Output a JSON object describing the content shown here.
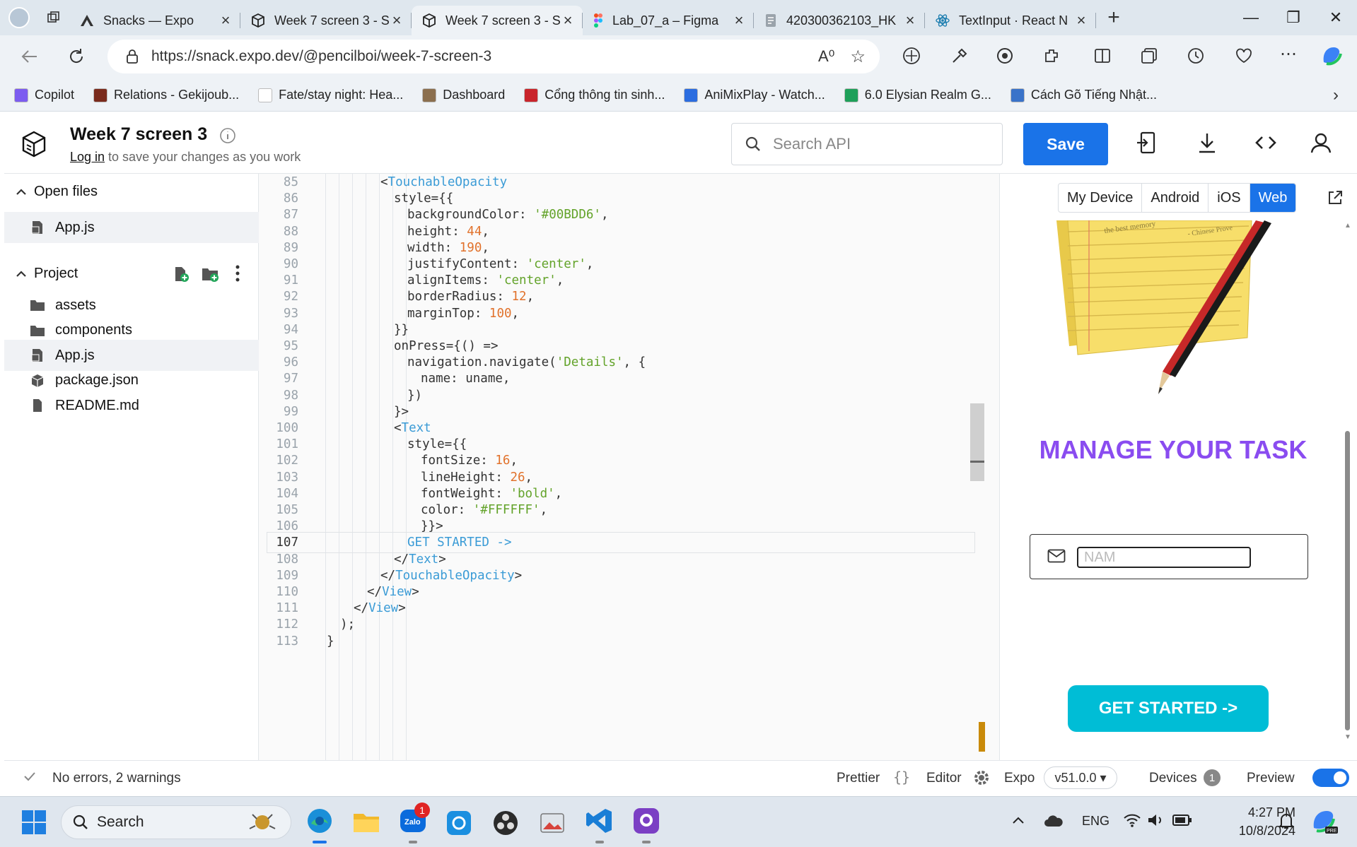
{
  "browser": {
    "tabs": [
      {
        "label": "Snacks — Expo",
        "icon": "expo-logo-icon",
        "active": false
      },
      {
        "label": "Week 7 screen 3 - S",
        "icon": "snack-cube-icon",
        "active": false
      },
      {
        "label": "Week 7 screen 3 - S",
        "icon": "snack-cube-icon",
        "active": true
      },
      {
        "label": "Lab_07_a – Figma",
        "icon": "figma-logo-icon",
        "active": false
      },
      {
        "label": "420300362103_HK",
        "icon": "document-icon",
        "active": false
      },
      {
        "label": "TextInput · React N",
        "icon": "react-logo-icon",
        "active": false
      }
    ],
    "url": "https://snack.expo.dev/@pencilboi/week-7-screen-3",
    "bookmarks": [
      {
        "label": "Copilot",
        "color": "#7c5cf0"
      },
      {
        "label": "Relations - Gekijoub...",
        "color": "#7a2b1c"
      },
      {
        "label": "Fate/stay night: Hea...",
        "color": "#ffffff"
      },
      {
        "label": "Dashboard",
        "color": "#8b6f4e"
      },
      {
        "label": "Cổng thông tin sinh...",
        "color": "#c9242b"
      },
      {
        "label": "AniMixPlay - Watch...",
        "color": "#2b6de0"
      },
      {
        "label": "6.0 Elysian Realm G...",
        "color": "#1ea05a"
      },
      {
        "label": "Cách Gõ Tiếng Nhật...",
        "color": "#3a73c9"
      }
    ]
  },
  "snack": {
    "title": "Week 7 screen 3",
    "login_link": "Log in",
    "login_suffix": " to save your changes as you work",
    "search_placeholder": "Search API",
    "save_label": "Save"
  },
  "sidebar": {
    "open_files_header": "Open files",
    "open_files": [
      {
        "label": "App.js",
        "icon": "js-file-icon"
      }
    ],
    "project_header": "Project",
    "project_items": [
      {
        "label": "assets",
        "icon": "folder-icon"
      },
      {
        "label": "components",
        "icon": "folder-icon"
      },
      {
        "label": "App.js",
        "icon": "js-file-icon"
      },
      {
        "label": "package.json",
        "icon": "package-icon"
      },
      {
        "label": "README.md",
        "icon": "document-icon"
      }
    ]
  },
  "editor": {
    "lines": [
      {
        "n": "85",
        "indent": 4,
        "parts": [
          [
            "",
            "<"
          ],
          [
            "tag",
            "TouchableOpacity"
          ]
        ]
      },
      {
        "n": "86",
        "indent": 5,
        "parts": [
          [
            "",
            "style={{"
          ]
        ]
      },
      {
        "n": "87",
        "indent": 6,
        "parts": [
          [
            "",
            "backgroundColor: "
          ],
          [
            "str",
            "'#00BDD6'"
          ],
          [
            "",
            ","
          ]
        ]
      },
      {
        "n": "88",
        "indent": 6,
        "parts": [
          [
            "",
            "height: "
          ],
          [
            "num",
            "44"
          ],
          [
            "",
            ","
          ]
        ]
      },
      {
        "n": "89",
        "indent": 6,
        "parts": [
          [
            "",
            "width: "
          ],
          [
            "num",
            "190"
          ],
          [
            "",
            ","
          ]
        ]
      },
      {
        "n": "90",
        "indent": 6,
        "parts": [
          [
            "",
            "justifyContent: "
          ],
          [
            "str",
            "'center'"
          ],
          [
            "",
            ","
          ]
        ]
      },
      {
        "n": "91",
        "indent": 6,
        "parts": [
          [
            "",
            "alignItems: "
          ],
          [
            "str",
            "'center'"
          ],
          [
            "",
            ","
          ]
        ]
      },
      {
        "n": "92",
        "indent": 6,
        "parts": [
          [
            "",
            "borderRadius: "
          ],
          [
            "num",
            "12"
          ],
          [
            "",
            ","
          ]
        ]
      },
      {
        "n": "93",
        "indent": 6,
        "parts": [
          [
            "",
            "marginTop: "
          ],
          [
            "num",
            "100"
          ],
          [
            "",
            ","
          ]
        ]
      },
      {
        "n": "94",
        "indent": 5,
        "parts": [
          [
            "",
            "}}"
          ]
        ]
      },
      {
        "n": "95",
        "indent": 5,
        "parts": [
          [
            "",
            "onPress={() =>"
          ]
        ]
      },
      {
        "n": "96",
        "indent": 6,
        "parts": [
          [
            "",
            "navigation.navigate("
          ],
          [
            "str",
            "'Details'"
          ],
          [
            "",
            ", {"
          ]
        ]
      },
      {
        "n": "97",
        "indent": 7,
        "parts": [
          [
            "",
            "name: uname,"
          ]
        ]
      },
      {
        "n": "98",
        "indent": 6,
        "parts": [
          [
            "",
            "})"
          ]
        ]
      },
      {
        "n": "99",
        "indent": 5,
        "parts": [
          [
            "",
            "}>"
          ]
        ]
      },
      {
        "n": "100",
        "indent": 5,
        "parts": [
          [
            "",
            "<"
          ],
          [
            "tag",
            "Text"
          ]
        ]
      },
      {
        "n": "101",
        "indent": 6,
        "parts": [
          [
            "",
            "style={{"
          ]
        ]
      },
      {
        "n": "102",
        "indent": 7,
        "parts": [
          [
            "",
            "fontSize: "
          ],
          [
            "num",
            "16"
          ],
          [
            "",
            ","
          ]
        ]
      },
      {
        "n": "103",
        "indent": 7,
        "parts": [
          [
            "",
            "lineHeight: "
          ],
          [
            "num",
            "26"
          ],
          [
            "",
            ","
          ]
        ]
      },
      {
        "n": "104",
        "indent": 7,
        "parts": [
          [
            "",
            "fontWeight: "
          ],
          [
            "str",
            "'bold'"
          ],
          [
            "",
            ","
          ]
        ]
      },
      {
        "n": "105",
        "indent": 7,
        "parts": [
          [
            "",
            "color: "
          ],
          [
            "str",
            "'#FFFFFF'"
          ],
          [
            "",
            ","
          ]
        ]
      },
      {
        "n": "106",
        "indent": 7,
        "parts": [
          [
            "",
            "}}>"
          ]
        ]
      },
      {
        "n": "107",
        "indent": 6,
        "parts": [
          [
            "tag",
            "GET STARTED ->"
          ]
        ]
      },
      {
        "n": "108",
        "indent": 5,
        "parts": [
          [
            "",
            "</"
          ],
          [
            "tag",
            "Text"
          ],
          [
            "",
            ">"
          ]
        ]
      },
      {
        "n": "109",
        "indent": 4,
        "parts": [
          [
            "",
            "</"
          ],
          [
            "tag",
            "TouchableOpacity"
          ],
          [
            "",
            ">"
          ]
        ]
      },
      {
        "n": "110",
        "indent": 3,
        "parts": [
          [
            "",
            "</"
          ],
          [
            "tag",
            "View"
          ],
          [
            "",
            ">"
          ]
        ]
      },
      {
        "n": "111",
        "indent": 2,
        "parts": [
          [
            "",
            "</"
          ],
          [
            "tag",
            "View"
          ],
          [
            "",
            ">"
          ]
        ]
      },
      {
        "n": "112",
        "indent": 1,
        "parts": [
          [
            "",
            ");"
          ]
        ]
      },
      {
        "n": "113",
        "indent": 0,
        "parts": [
          [
            "",
            "}"
          ]
        ]
      }
    ]
  },
  "preview": {
    "device_tabs": [
      "My Device",
      "Android",
      "iOS",
      "Web"
    ],
    "active_device": "Web",
    "heading": "MANAGE YOUR TASK",
    "name_placeholder": "NAM",
    "button_label": "GET STARTED ->"
  },
  "statusbar": {
    "problems": "No errors, 2 warnings",
    "prettier": "Prettier",
    "editor": "Editor",
    "expo": "Expo",
    "version": "v51.0.0 ▾",
    "devices": "Devices",
    "devices_count": "1",
    "preview": "Preview"
  },
  "taskbar": {
    "search_label": "Search",
    "zalo_badge": "1",
    "language": "ENG",
    "time": "4:27 PM",
    "date": "10/8/2024"
  },
  "colors": {
    "accent": "#1a73e8",
    "cyan_button": "#00BDD6",
    "heading_purple": "#8a4cf0"
  }
}
